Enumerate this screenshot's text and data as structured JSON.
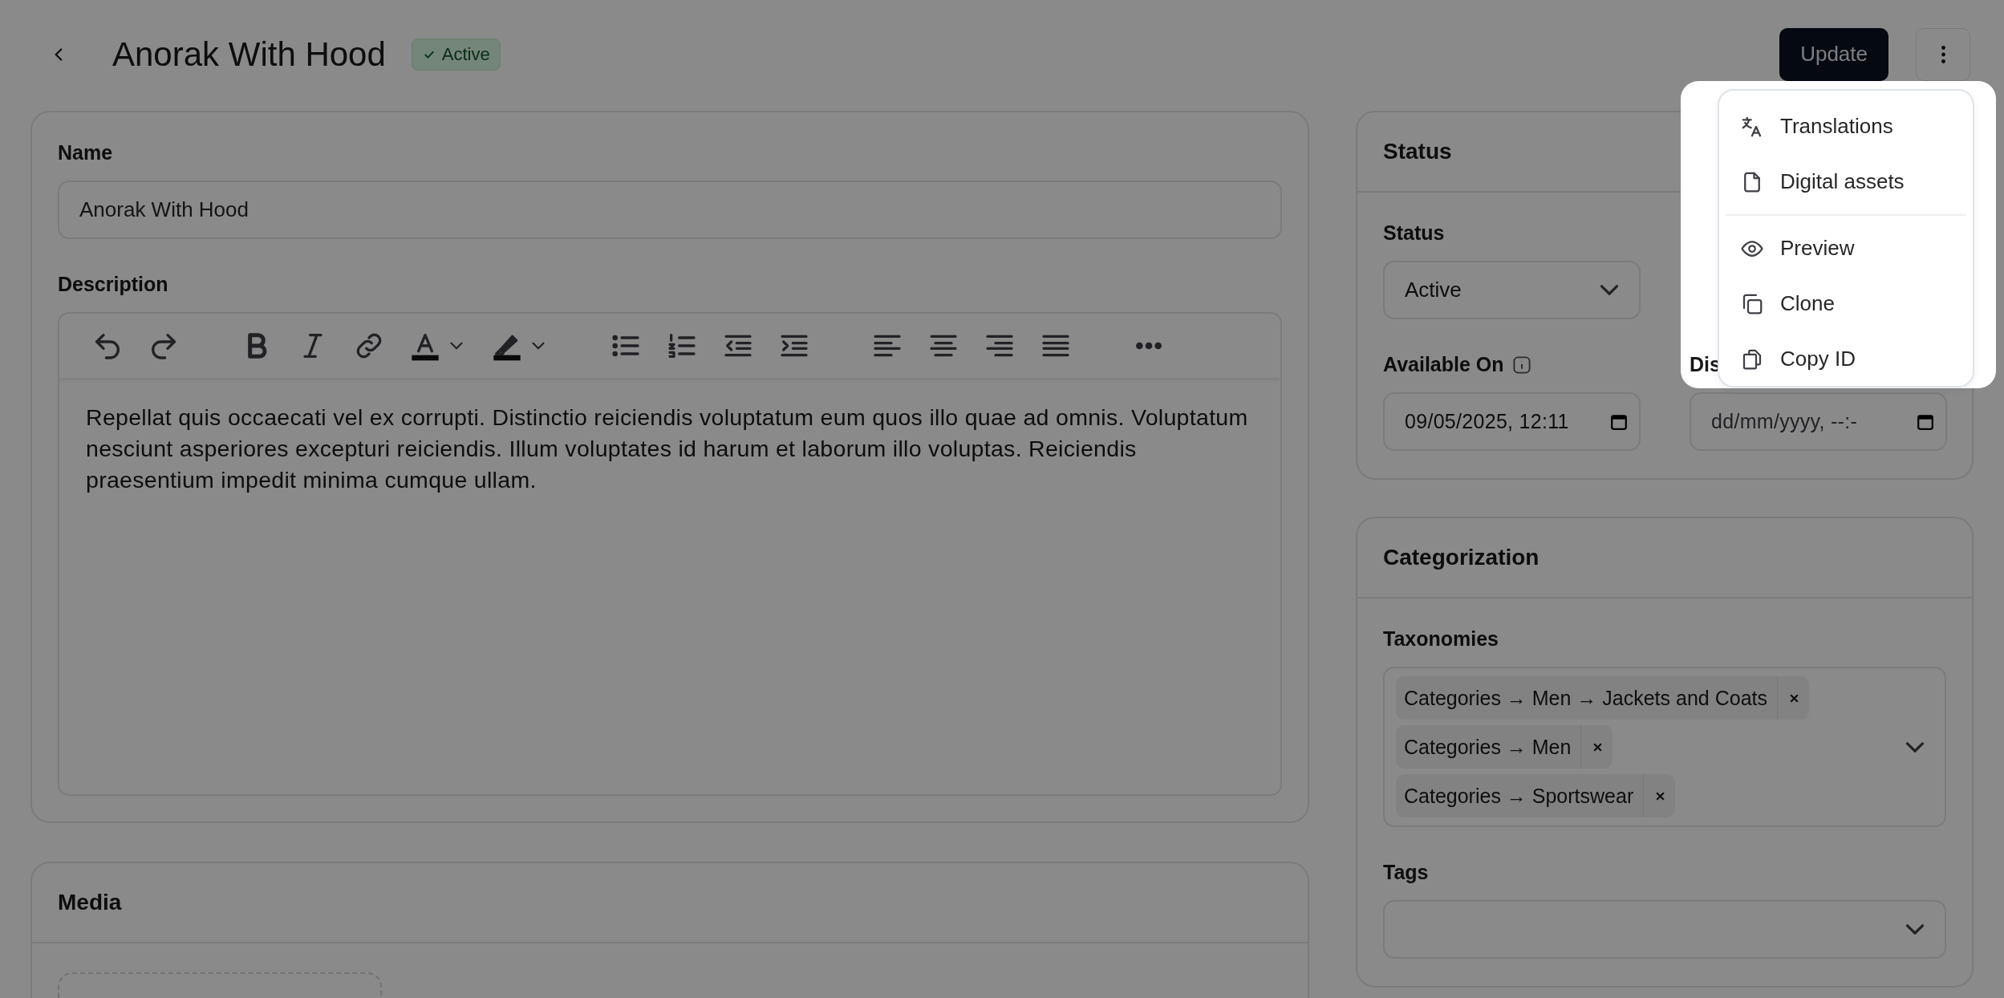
{
  "header": {
    "title": "Anorak With Hood",
    "badge": "Active"
  },
  "actions": {
    "primary": "Update"
  },
  "general": {
    "name": {
      "label": "Name",
      "value": "Anorak With Hood"
    },
    "description": {
      "label": "Description",
      "text": "Repellat quis occaecati vel ex corrupti. Distinctio reiciendis voluptatum eum quos illo quae ad omnis. Voluptatum nesciunt asperiores excepturi reiciendis. Illum voluptates id harum et laborum illo voluptas. Reiciendis praesentium impedit minima cumque ullam."
    }
  },
  "media": {
    "title": "Media"
  },
  "status_card": {
    "title": "Status",
    "status": {
      "label": "Status",
      "value": "Active"
    },
    "available_on": {
      "label": "Available On",
      "value": "09/05/2025, 12:11"
    },
    "second_date": {
      "label": "Dis",
      "placeholder": "dd/mm/yyyy, --:-"
    }
  },
  "categorization": {
    "title": "Categorization",
    "taxonomies": {
      "label": "Taxonomies",
      "chips": [
        "Categories → Men → Jackets and Coats",
        "Categories → Men",
        "Categories → Sportswear"
      ]
    },
    "tags": {
      "label": "Tags"
    }
  },
  "menu": {
    "open": true,
    "items": [
      {
        "kind": "item",
        "label": "Translations"
      },
      {
        "kind": "item",
        "label": "Digital assets"
      },
      {
        "kind": "divider"
      },
      {
        "kind": "item",
        "label": "Preview"
      },
      {
        "kind": "item",
        "label": "Clone"
      },
      {
        "kind": "item",
        "label": "Copy ID"
      }
    ]
  }
}
